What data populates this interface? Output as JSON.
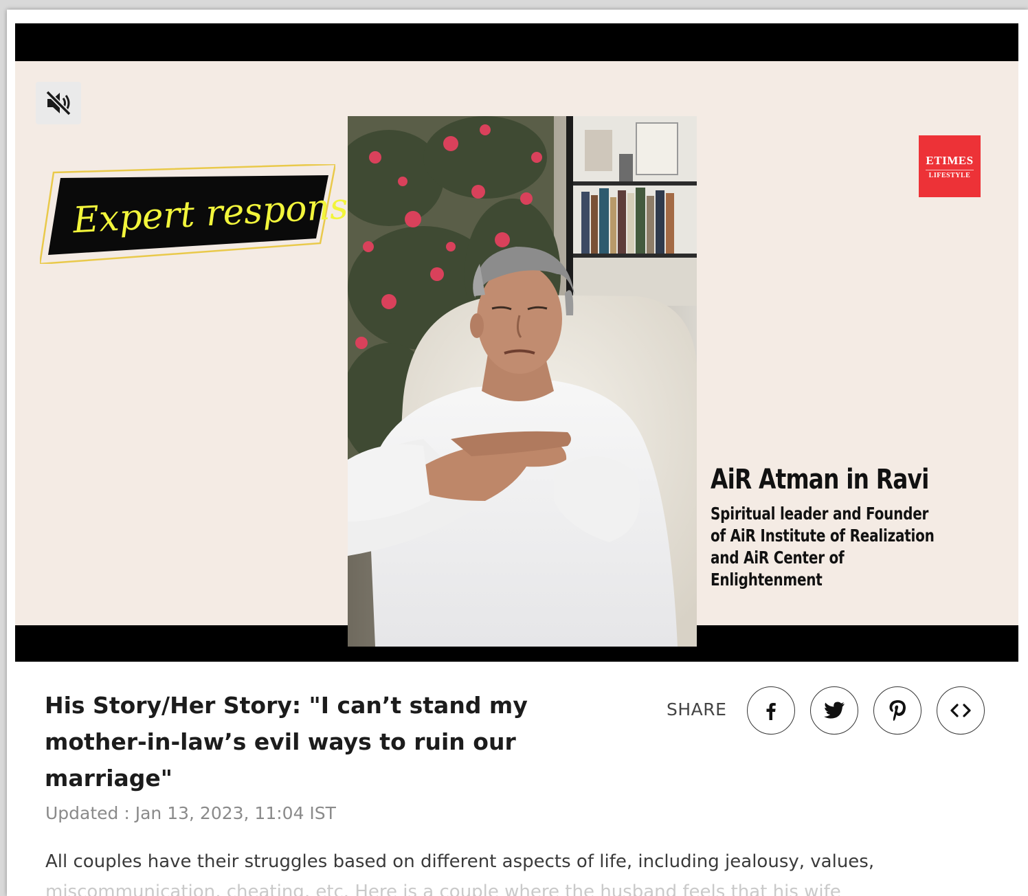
{
  "video": {
    "overlay_badge": "Expert response:",
    "brand": {
      "line1": "ETIMES",
      "line2": "LIFESTYLE",
      "color": "#ed3237"
    },
    "expert_name": "AiR Atman in Ravi",
    "expert_title": "Spiritual leader and Founder of AiR Institute of Realization and AiR Center of Enlightenment",
    "mute_icon": "speaker-muted-icon",
    "background_color": "#f4ebe4"
  },
  "article": {
    "headline": "His Story/Her Story: \"I can’t stand my mother-in-law’s evil ways to ruin our marriage\"",
    "updated": "Updated : Jan 13, 2023, 11:04 IST",
    "body_line1": "All couples have their struggles based on different aspects of life, including jealousy, values,",
    "body_line2": "miscommunication, cheating, etc. Here is a couple where the husband feels that his wife"
  },
  "share": {
    "label": "SHARE",
    "buttons": [
      {
        "icon": "facebook-icon"
      },
      {
        "icon": "twitter-icon"
      },
      {
        "icon": "pinterest-icon"
      },
      {
        "icon": "embed-code-icon"
      }
    ]
  }
}
